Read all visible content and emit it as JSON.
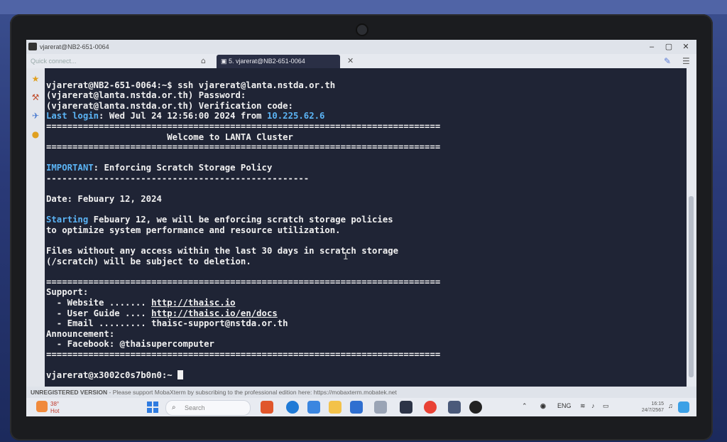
{
  "window": {
    "title": "vjarerat@NB2-651-0064",
    "minimize_icon": "minimize-icon",
    "maximize_icon": "maximize-icon",
    "close_icon": "close-icon"
  },
  "tabs": {
    "quick_connect_placeholder": "Quick connect...",
    "active_tab_label": "5. vjarerat@NB2-651-0064"
  },
  "terminal": {
    "lines": {
      "l1_prompt": "vjarerat@NB2-651-0064",
      "l1_rest": ":~$ ssh vjarerat@lanta.nstda.or.th",
      "l2": "(vjarerat@lanta.nstda.or.th) Password:",
      "l3": "(vjarerat@lanta.nstda.or.th) Verification code:",
      "l4_label": "Last login",
      "l4_mid": ": Wed Jul 24 12:56:00 2024 from ",
      "l4_ip": "10.225.62.6",
      "rule_eq": "===========================================================================",
      "welcome": "                       Welcome to LANTA Cluster",
      "important_label": "IMPORTANT",
      "important_rest": ": Enforcing Scratch Storage Policy",
      "rule_dash": "--------------------------------------------------",
      "date": "Date: Febuary 12, 2024",
      "starting_label": "Starting",
      "starting_rest": " Febuary 12, we will be enforcing scratch storage policies",
      "starting_2": "to optimize system performance and resource utilization.",
      "files_1": "Files without any access within the last 30 days in scratch storage",
      "files_2": "(/scratch) will be subject to deletion.",
      "support": "Support:",
      "website_label": "  - Website ....... ",
      "website_url": "http://thaisc.io",
      "guide_label": "  - User Guide .... ",
      "guide_url": "http://thaisc.io/en/docs",
      "email": "  - Email ......... thaisc-support@nstda.or.th",
      "announcement": "Announcement:",
      "facebook": "  - Facebook: @thaisupercomputer",
      "final_prompt": "vjarerat@x3002c0s7b0n0:~ "
    }
  },
  "statusbar": {
    "unregistered": "UNREGISTERED VERSION",
    "message": "  -  Please support MobaXterm by subscribing to the professional edition here:  ",
    "url": "https://mobaxterm.mobatek.net"
  },
  "taskbar": {
    "weather_temp": "38°",
    "weather_desc": "Hot",
    "search_placeholder": "Search",
    "lang": "ENG",
    "time": "16:15",
    "date": "24/7/2567"
  },
  "colors": {
    "terminal_bg": "#1f2435",
    "highlight": "#5bb4f5"
  }
}
